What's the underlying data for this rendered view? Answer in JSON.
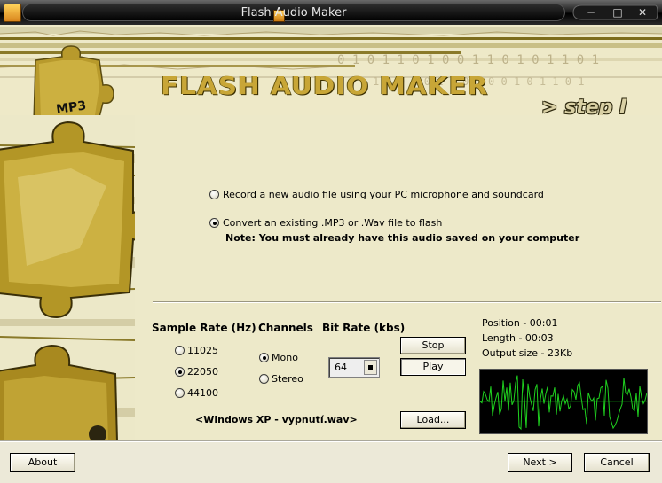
{
  "window": {
    "title": "Flash Audio Maker",
    "app_icon_text": "Flash\nFAM",
    "controls": [
      "minimize",
      "maximize",
      "close"
    ]
  },
  "banner": {
    "brand_title": "FLASH AUDIO MAKER",
    "step_label": "> step I",
    "puzzle_badge": "MP3"
  },
  "source": {
    "options": [
      {
        "label": "Record a new audio file using your PC microphone and soundcard",
        "selected": false
      },
      {
        "label": "Convert an existing .MP3 or .Wav file to flash",
        "selected": true
      }
    ],
    "note": "Note: You must already have this audio saved on your computer"
  },
  "sample_rate": {
    "header": "Sample Rate (Hz)",
    "options": [
      {
        "label": "11025",
        "selected": false
      },
      {
        "label": "22050",
        "selected": true
      },
      {
        "label": "44100",
        "selected": false
      }
    ]
  },
  "channels": {
    "header": "Channels",
    "options": [
      {
        "label": "Mono",
        "selected": true
      },
      {
        "label": "Stereo",
        "selected": false
      }
    ]
  },
  "bit_rate": {
    "header": "Bit Rate (kbs)",
    "value": "64"
  },
  "playback": {
    "stop_label": "Stop",
    "play_label": "Play",
    "load_label": "Load...",
    "file_label": "<Windows XP  - vypnutí.wav>",
    "position": "Position - 00:01",
    "length": "Length  - 00:03",
    "output_size": "Output size - 23Kb",
    "wave_color": "#1fd11f"
  },
  "footer": {
    "about_label": "About",
    "next_label": "Next >",
    "cancel_label": "Cancel"
  },
  "colors": {
    "background": "#ece8c8",
    "gold": "#c8a637",
    "wave_bg": "#000000"
  }
}
